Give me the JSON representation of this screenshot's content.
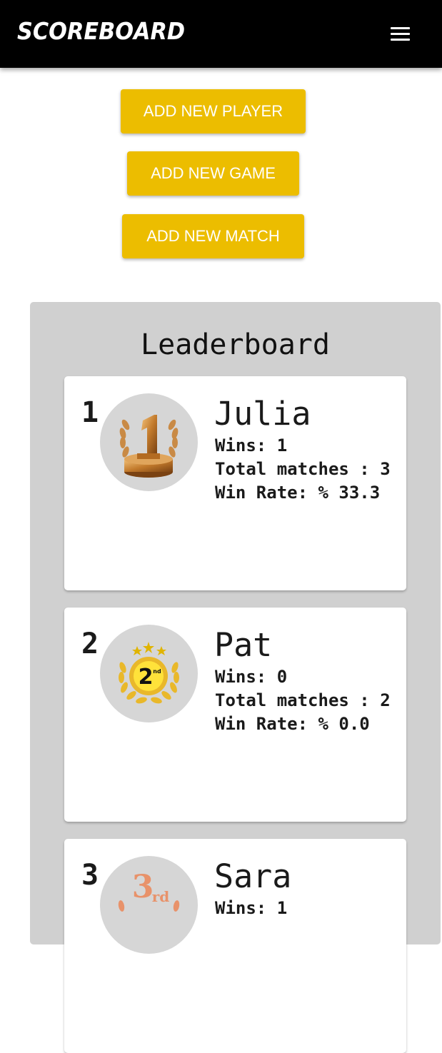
{
  "app": {
    "title": "SCOREBOARD",
    "menu_icon": "hamburger-menu-icon"
  },
  "actions": {
    "add_player": "ADD NEW PLAYER",
    "add_game": "ADD NEW GAME",
    "add_match": "ADD NEW MATCH"
  },
  "leaderboard": {
    "title": "Leaderboard",
    "wins_label": "Wins:",
    "total_label": "Total matches :",
    "rate_label": "Win Rate: %",
    "players": [
      {
        "rank": "1",
        "name": "Julia",
        "wins": "1",
        "total": "3",
        "rate": "33.3",
        "medal_icon": "first-place-trophy-icon"
      },
      {
        "rank": "2",
        "name": "Pat",
        "wins": "0",
        "total": "2",
        "rate": "0.0",
        "medal_icon": "second-place-medal-icon"
      },
      {
        "rank": "3",
        "name": "Sara",
        "wins": "1",
        "total": "",
        "rate": "",
        "medal_icon": "third-place-medal-icon"
      }
    ]
  },
  "colors": {
    "appbar": "#000000",
    "accent": "#ecbd00",
    "panel": "#d0d0d0",
    "medal_bg": "#d6d6d6"
  }
}
